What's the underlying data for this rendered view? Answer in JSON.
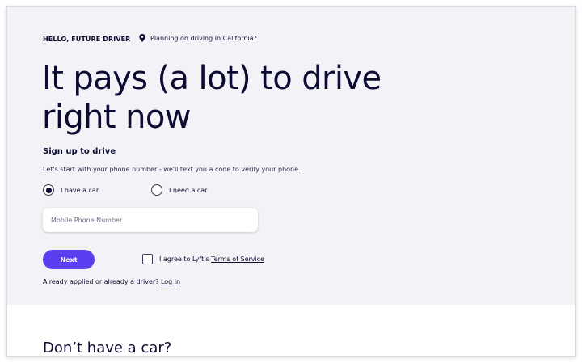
{
  "hero": {
    "eyebrow": "HELLO, FUTURE DRIVER",
    "location_text": "Planning on driving in California?",
    "location_icon": "map-pin-icon",
    "headline": "It pays (a lot) to drive right now",
    "subhead": "Sign up to drive",
    "helper": "Let's start with your phone number - we'll text you a code to verify your phone."
  },
  "form": {
    "options": [
      {
        "label": "I have a car",
        "selected": true
      },
      {
        "label": "I need a car",
        "selected": false
      }
    ],
    "phone_placeholder": "Mobile Phone Number",
    "phone_value": "",
    "next_label": "Next",
    "agree_prefix": "I agree to Lyft's ",
    "tos_label": "Terms of Service",
    "agree_checked": false,
    "already_text": "Already applied or already a driver? ",
    "login_label": "Log in"
  },
  "lower": {
    "title": "Don’t have a car?"
  },
  "colors": {
    "hero_bg": "#f3f3f7",
    "text": "#0c0b31",
    "accent": "#5a3ff1"
  }
}
